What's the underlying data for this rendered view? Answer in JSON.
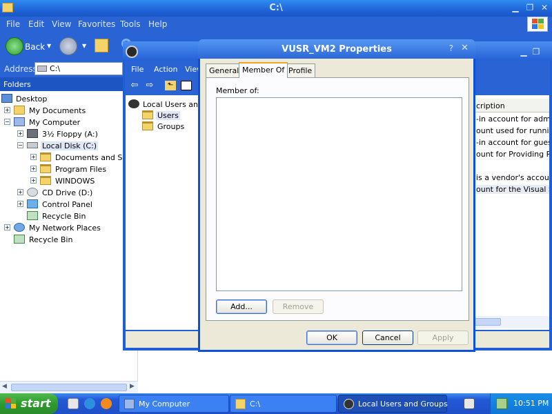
{
  "explorer": {
    "title": "C:\\",
    "menu": [
      "File",
      "Edit",
      "View",
      "Favorites",
      "Tools",
      "Help"
    ],
    "toolbar": {
      "back": "Back"
    },
    "address": {
      "label": "Address",
      "value": "C:\\"
    },
    "folders_header": "Folders",
    "tree": [
      {
        "label": "Desktop",
        "icon": "desktop-icon"
      },
      {
        "label": "My Documents",
        "icon": "documents-icon"
      },
      {
        "label": "My Computer",
        "icon": "computer-icon"
      },
      {
        "label": "3½ Floppy (A:)",
        "icon": "floppy-icon"
      },
      {
        "label": "Local Disk (C:)",
        "icon": "disk-icon"
      },
      {
        "label": "Documents and Setti",
        "icon": "folder-icon"
      },
      {
        "label": "Program Files",
        "icon": "folder-icon"
      },
      {
        "label": "WINDOWS",
        "icon": "folder-icon"
      },
      {
        "label": "CD Drive (D:)",
        "icon": "cd-icon"
      },
      {
        "label": "Control Panel",
        "icon": "control-panel-icon"
      },
      {
        "label": "Recycle Bin",
        "icon": "recycle-bin-icon"
      },
      {
        "label": "My Network Places",
        "icon": "network-icon"
      },
      {
        "label": "Recycle Bin",
        "icon": "recycle-bin-icon"
      }
    ]
  },
  "lusrmgr": {
    "menu": [
      "File",
      "Action",
      "View"
    ],
    "tree": {
      "root": "Local Users and G",
      "users": "Users",
      "groups": "Groups"
    },
    "list_header": "cription",
    "rows": [
      "-in account for adminis",
      "ount used for running",
      "-in account for guest a",
      "ount for Providing Rem",
      "",
      "is a vendor's account",
      "ount for the Visual Stu"
    ]
  },
  "dialog": {
    "title": "VUSR_VM2 Properties",
    "help": "?",
    "close": "✕",
    "tabs": [
      "General",
      "Member Of",
      "Profile"
    ],
    "member_of_label": "Member of:",
    "buttons": {
      "add": "Add...",
      "remove": "Remove",
      "ok": "OK",
      "cancel": "Cancel",
      "apply": "Apply"
    }
  },
  "taskbar": {
    "start": "start",
    "tasks": [
      "My Computer",
      "C:\\",
      "Local Users and Groups"
    ],
    "clock": "10:51 PM"
  },
  "colors": {
    "titlebar": "#1f64d8",
    "dialog_frame": "#0a53d8",
    "start": "#2f9a2f",
    "face": "#ece9d8"
  }
}
